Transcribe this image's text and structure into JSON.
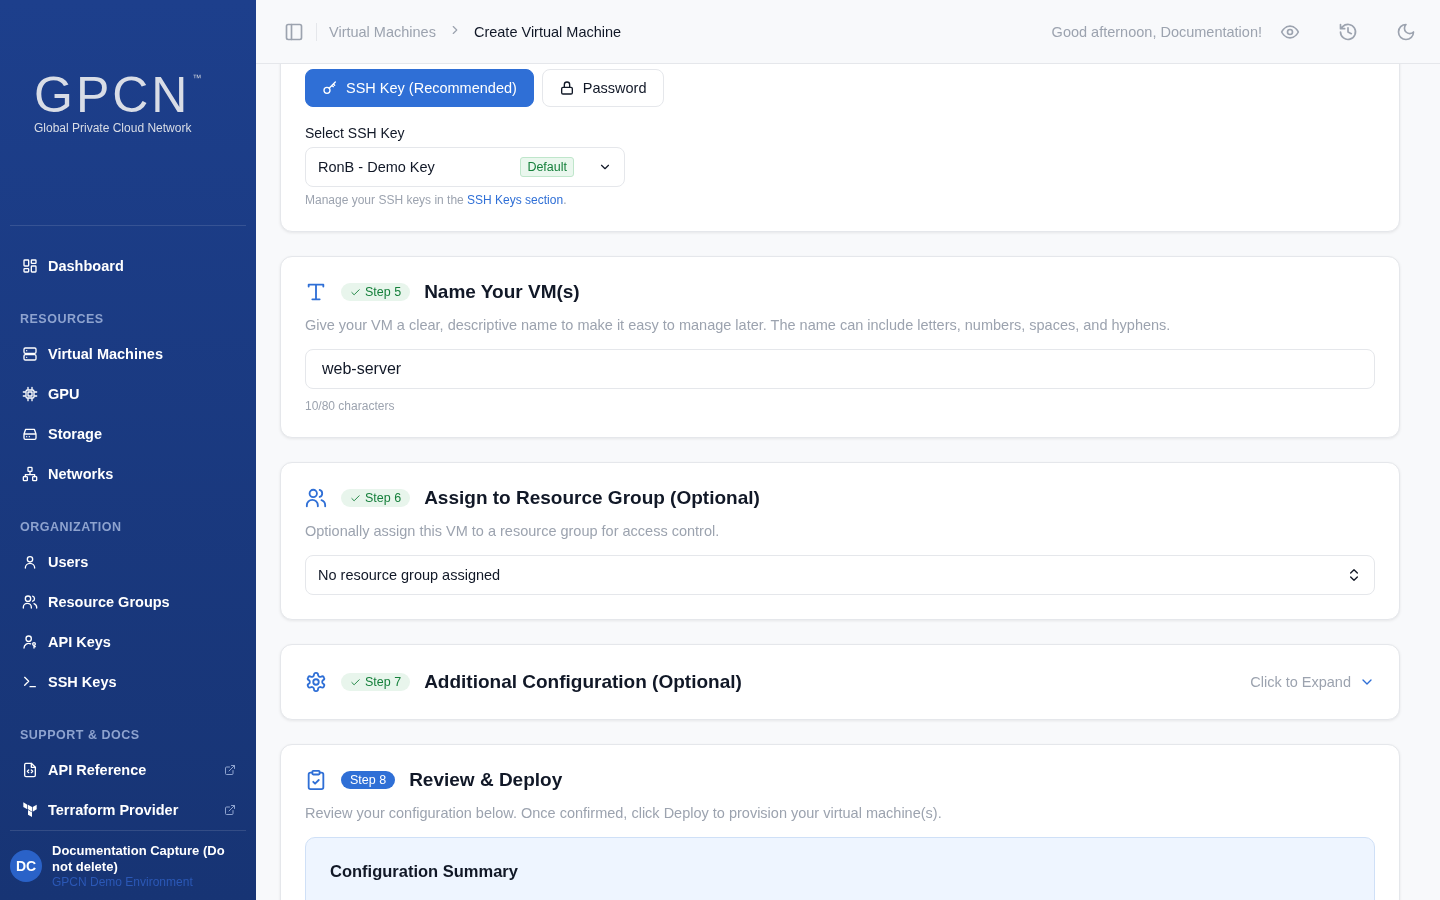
{
  "sidebar": {
    "logo": {
      "wordmark": "GPCN",
      "trademark": "™",
      "tagline": "Global Private Cloud Network"
    },
    "sections": [
      {
        "items": [
          {
            "label": "Dashboard",
            "external": false
          }
        ]
      },
      {
        "heading": "RESOURCES",
        "items": [
          {
            "label": "Virtual Machines",
            "external": false
          },
          {
            "label": "GPU",
            "external": false
          },
          {
            "label": "Storage",
            "external": false
          },
          {
            "label": "Networks",
            "external": false
          }
        ]
      },
      {
        "heading": "ORGANIZATION",
        "items": [
          {
            "label": "Users",
            "external": false
          },
          {
            "label": "Resource Groups",
            "external": false
          },
          {
            "label": "API Keys",
            "external": false
          },
          {
            "label": "SSH Keys",
            "external": false
          }
        ]
      },
      {
        "heading": "SUPPORT & DOCS",
        "items": [
          {
            "label": "API Reference",
            "external": true
          },
          {
            "label": "Terraform Provider",
            "external": true
          }
        ]
      }
    ],
    "user": {
      "initials": "DC",
      "name": "Documentation Capture (Do not delete)",
      "org": "GPCN Demo Environment"
    }
  },
  "header": {
    "breadcrumb": [
      "Virtual Machines",
      "Create Virtual Machine"
    ],
    "greeting": "Good afternoon, Documentation!"
  },
  "auth": {
    "options": [
      {
        "label": "SSH Key (Recommended)",
        "selected": true
      },
      {
        "label": "Password",
        "selected": false
      }
    ],
    "select_label": "Select SSH Key",
    "select_value": "RonB - Demo Key",
    "select_badge": "Default",
    "help_prefix": "Manage your SSH keys in the ",
    "help_link": "SSH Keys section",
    "help_suffix": "."
  },
  "steps": [
    {
      "kind": "input",
      "step": "Step 5",
      "completed": true,
      "title": "Name Your VM(s)",
      "description": "Give your VM a clear, descriptive name to make it easy to manage later. The name can include letters, numbers, spaces, and hyphens.",
      "value": "web-server",
      "hint": "10/80 characters"
    },
    {
      "kind": "select",
      "step": "Step 6",
      "completed": true,
      "title": "Assign to Resource Group (Optional)",
      "description": "Optionally assign this VM to a resource group for access control.",
      "value": "No resource group assigned"
    },
    {
      "kind": "collapsible",
      "step": "Step 7",
      "completed": true,
      "title": "Additional Configuration (Optional)",
      "expand_label": "Click to Expand",
      "expanded": false
    },
    {
      "kind": "summary",
      "step": "Step 8",
      "completed": false,
      "title": "Review & Deploy",
      "description": "Review your configuration below. Once confirmed, click Deploy to provision your virtual machine(s).",
      "summary_title": "Configuration Summary"
    }
  ]
}
